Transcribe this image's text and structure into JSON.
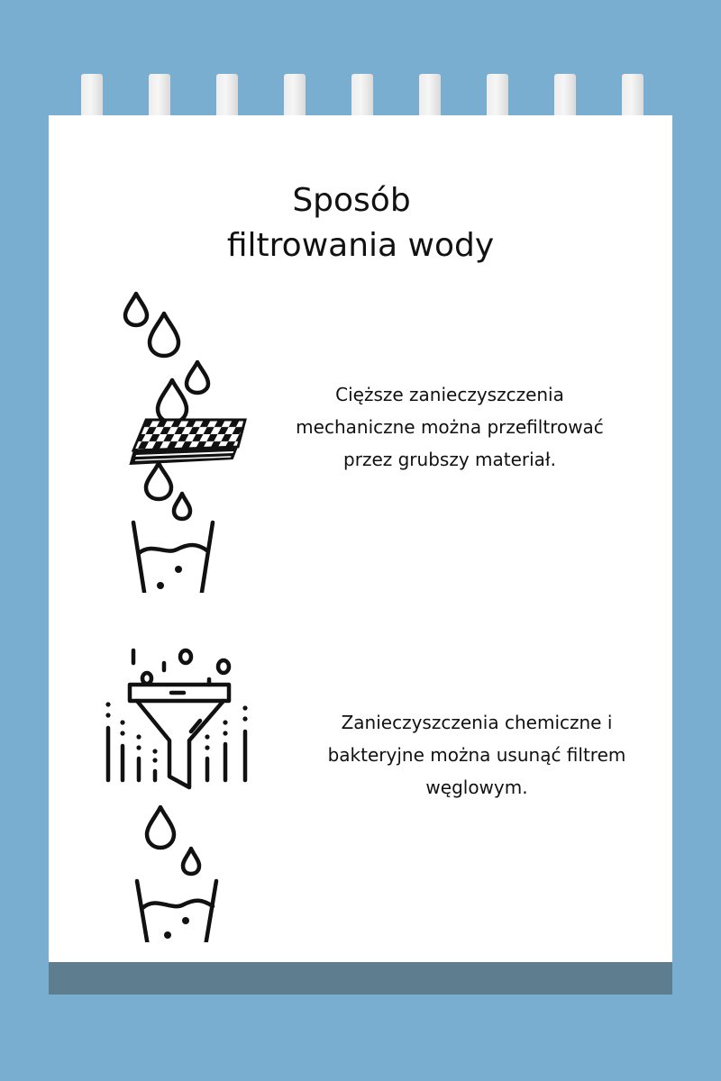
{
  "title": {
    "line1": "Sposób",
    "line2": "filtrowania wody"
  },
  "steps": [
    {
      "lines": [
        "Cięższe zanieczyszczenia",
        "mechaniczne można przefiltrować",
        "przez grubszy materiał."
      ],
      "icon": "cloth-filter-icon"
    },
    {
      "lines": [
        "Zanieczyszczenia chemiczne i",
        "bakteryjne można usunąć filtrem",
        "węglowym."
      ],
      "icon": "carbon-filter-funnel-icon"
    }
  ],
  "colors": {
    "background": "#7aaed0",
    "page": "#ffffff",
    "footer": "#5e7e90",
    "ink": "#111111"
  }
}
